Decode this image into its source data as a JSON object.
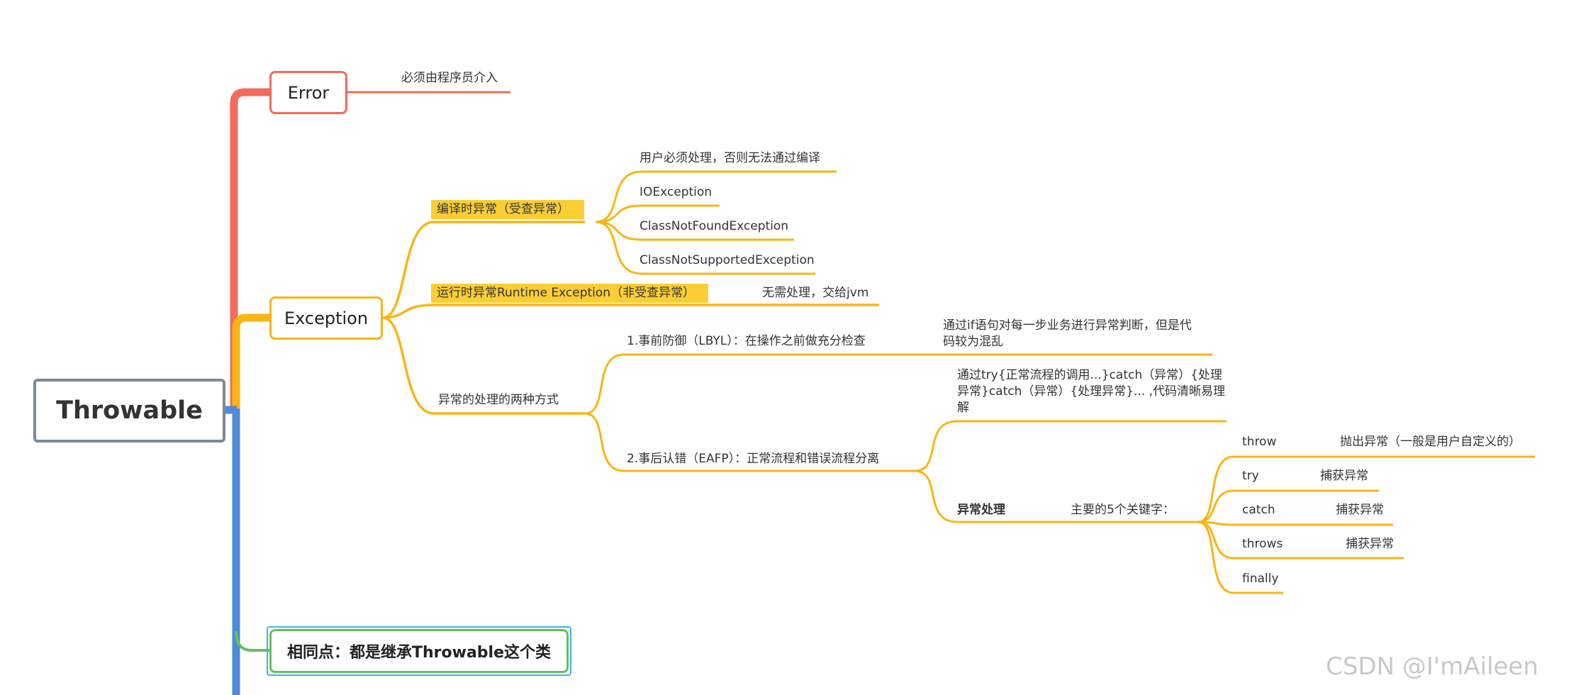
{
  "root": {
    "label": "Throwable"
  },
  "error": {
    "label": "Error",
    "note": "必须由程序员介入"
  },
  "exception": {
    "label": "Exception",
    "checked": {
      "label": "编译时异常（受查异常）",
      "items": [
        "用户必须处理，否则无法通过编译",
        "IOException",
        "ClassNotFoundException",
        "ClassNotSupportedException"
      ]
    },
    "runtime": {
      "label": "运行时异常Runtime Exception（非受查异常）",
      "note": "无需处理，交给jvm"
    },
    "handling": {
      "label": "异常的处理的两种方式",
      "lbyl": {
        "label": "1.事前防御（LBYL）：在操作之前做充分检查",
        "note_line1": "通过if语句对每一步业务进行异常判断，但是代",
        "note_line2": "码较为混乱"
      },
      "eafp": {
        "label": "2.事后认错（EAFP）：正常流程和错误流程分离",
        "note_line1": "通过try{正常流程的调用...}catch（异常）{处理",
        "note_line2": "异常}catch（异常）{处理异常}... ,代码清晰易理",
        "note_line3": "解",
        "handle": {
          "label": "异常处理",
          "keywords_label": "主要的5个关键字：",
          "keywords": [
            {
              "name": "throw",
              "desc": "抛出异常（一般是用户自定义的）"
            },
            {
              "name": "try",
              "desc": "捕获异常"
            },
            {
              "name": "catch",
              "desc": "捕获异常"
            },
            {
              "name": "throws",
              "desc": "捕获异常"
            },
            {
              "name": "finally",
              "desc": ""
            }
          ]
        }
      }
    }
  },
  "common": {
    "label": "相同点：都是继承Throwable这个类"
  },
  "watermark": "CSDN @I'mAileen",
  "colors": {
    "red": "#f26b5b",
    "orange": "#f9b514",
    "blue": "#5089d8",
    "green": "#67bf5c",
    "gray": "#7f8899",
    "highlight": "#fbcf34"
  }
}
